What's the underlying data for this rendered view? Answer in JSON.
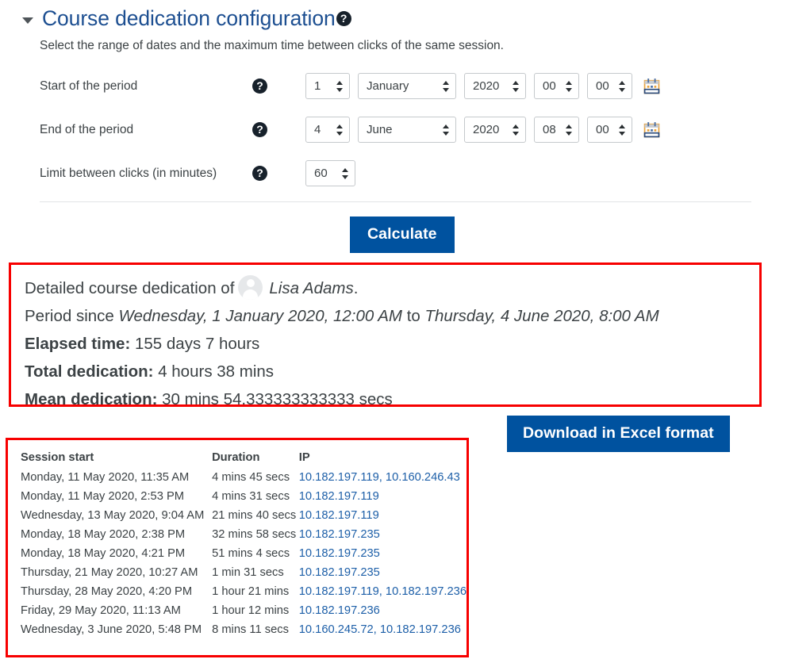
{
  "header": {
    "title": "Course dedication configuration",
    "help_icon": "help-circle-icon",
    "collapse_icon": "caret-down-icon",
    "intro": "Select the range of dates and the maximum time between clicks of the same session."
  },
  "form": {
    "rows": [
      {
        "label": "Start of the period",
        "day": "1",
        "month": "January",
        "year": "2020",
        "hour": "00",
        "minute": "00",
        "calendar_icon": "calendar-icon"
      },
      {
        "label": "End of the period",
        "day": "4",
        "month": "June",
        "year": "2020",
        "hour": "08",
        "minute": "00",
        "calendar_icon": "calendar-icon"
      }
    ],
    "limit": {
      "label": "Limit between clicks (in minutes)",
      "value": "60"
    },
    "calculate_label": "Calculate"
  },
  "summary": {
    "title_prefix": "Detailed course dedication of",
    "user_name": "Lisa Adams",
    "title_suffix": ".",
    "period_prefix": "Period since",
    "period_start": "Wednesday, 1 January 2020, 12:00 AM",
    "period_join": "to",
    "period_end": "Thursday, 4 June 2020, 8:00 AM",
    "elapsed_label": "Elapsed time:",
    "elapsed_value": "155 days 7 hours",
    "total_label": "Total dedication:",
    "total_value": "4 hours 38 mins",
    "mean_label": "Mean dedication:",
    "mean_value": "30 mins 54.333333333333 secs"
  },
  "download": {
    "label": "Download in Excel format"
  },
  "table": {
    "columns": [
      "Session start",
      "Duration",
      "IP"
    ],
    "rows": [
      {
        "start": "Monday, 11 May 2020, 11:35 AM",
        "duration": "4 mins 45 secs",
        "ip": "10.182.197.119, 10.160.246.43"
      },
      {
        "start": "Monday, 11 May 2020, 2:53 PM",
        "duration": "4 mins 31 secs",
        "ip": "10.182.197.119"
      },
      {
        "start": "Wednesday, 13 May 2020, 9:04 AM",
        "duration": "21 mins 40 secs",
        "ip": "10.182.197.119"
      },
      {
        "start": "Monday, 18 May 2020, 2:38 PM",
        "duration": "32 mins 58 secs",
        "ip": "10.182.197.235"
      },
      {
        "start": "Monday, 18 May 2020, 4:21 PM",
        "duration": "51 mins 4 secs",
        "ip": "10.182.197.235"
      },
      {
        "start": "Thursday, 21 May 2020, 10:27 AM",
        "duration": "1 min 31 secs",
        "ip": "10.182.197.235"
      },
      {
        "start": "Thursday, 28 May 2020, 4:20 PM",
        "duration": "1 hour 21 mins",
        "ip": "10.182.197.119, 10.182.197.236"
      },
      {
        "start": "Friday, 29 May 2020, 11:13 AM",
        "duration": "1 hour 12 mins",
        "ip": "10.182.197.236"
      },
      {
        "start": "Wednesday, 3 June 2020, 5:48 PM",
        "duration": "8 mins 11 secs",
        "ip": "10.160.245.72, 10.182.197.236"
      }
    ]
  },
  "colors": {
    "title": "#1d4f91",
    "button": "#00529f",
    "highlight_border": "#f70000",
    "link": "#1d5fa8"
  }
}
